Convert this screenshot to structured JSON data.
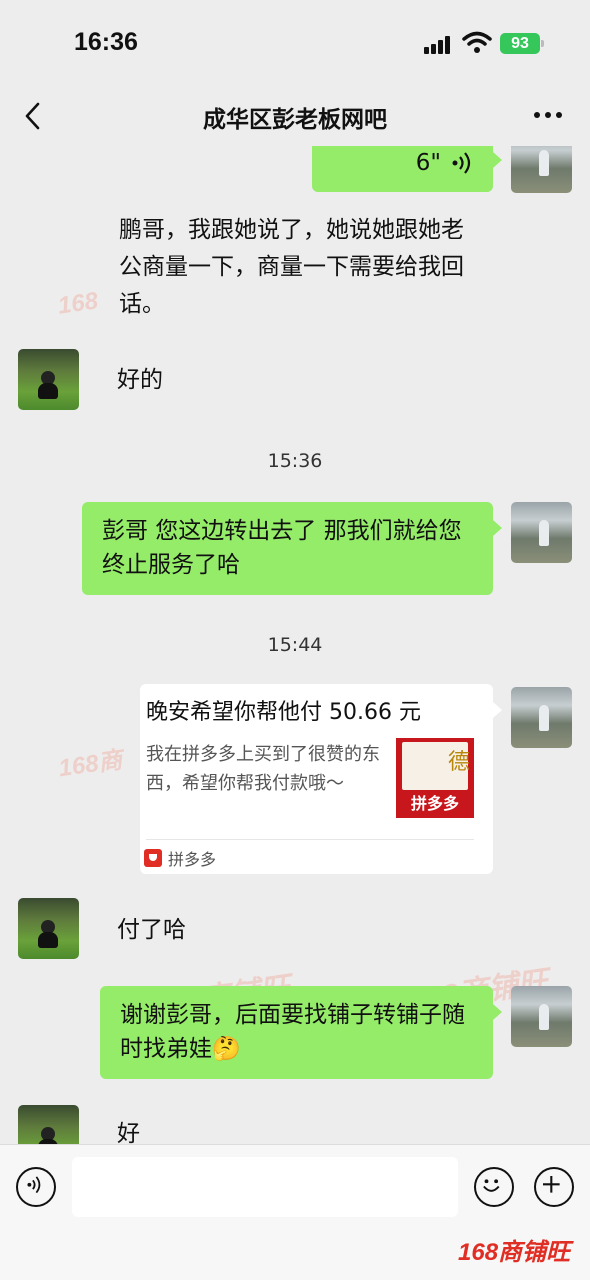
{
  "status": {
    "time": "16:36",
    "battery": "93"
  },
  "nav": {
    "title": "成华区彭老板网吧"
  },
  "messages": {
    "voice_duration": "6\"",
    "m1": "鹏哥，我跟她说了，她说她跟她老公商量一下，商量一下需要给我回话。",
    "m2": "好的",
    "t1": "15:36",
    "m3": "彭哥  您这边转出去了 那我们就给您终止服务了哈",
    "t2": "15:44",
    "card": {
      "title": "晚安希望你帮他付 50.66 元",
      "desc": "我在拼多多上买到了很赞的东西，希望你帮我付款哦～",
      "thumb_label": "拼多多",
      "thumb_char": "德",
      "source": "拼多多"
    },
    "m4": "付了哈",
    "m5": "谢谢彭哥，后面要找铺子转铺子随时找弟娃🤔",
    "m6": "好"
  },
  "watermarks": {
    "w1": "168",
    "w2": "168商",
    "w3": "168商铺旺",
    "w4": "168商铺旺"
  },
  "brand": "168商铺旺",
  "icons": [
    "signal-icon",
    "wifi-icon",
    "battery-icon",
    "back-arrow-icon",
    "more-icon",
    "voice-wave-icon",
    "pinduoduo-icon",
    "voice-input-icon",
    "emoji-icon",
    "plus-icon"
  ]
}
